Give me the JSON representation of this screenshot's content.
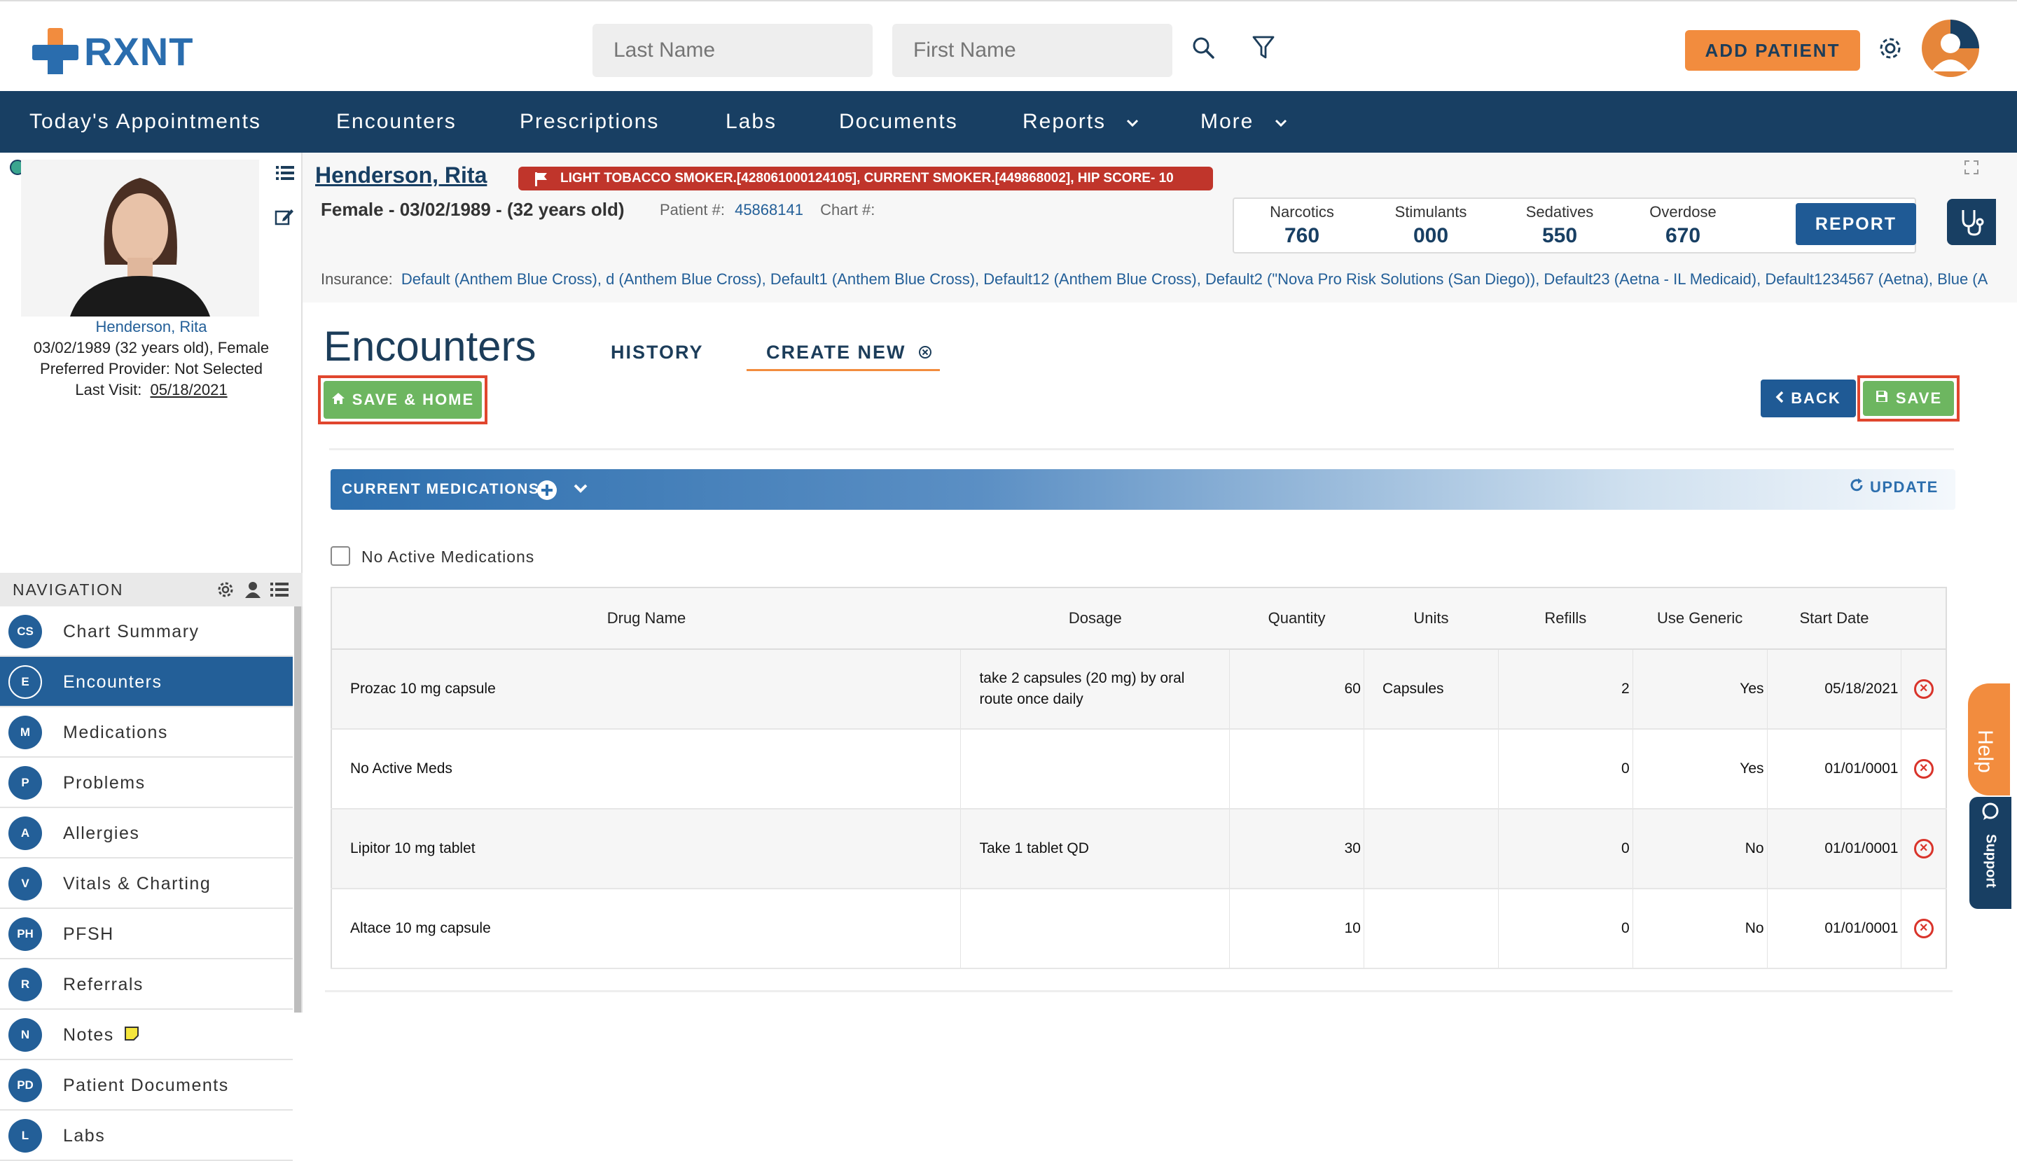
{
  "app": {
    "logo_text": "RXNT"
  },
  "topbar": {
    "last_name_placeholder": "Last Name",
    "first_name_placeholder": "First Name",
    "add_patient_label": "ADD PATIENT"
  },
  "nav": {
    "items": [
      {
        "label": "Today's Appointments"
      },
      {
        "label": "Encounters"
      },
      {
        "label": "Prescriptions"
      },
      {
        "label": "Labs"
      },
      {
        "label": "Documents"
      },
      {
        "label": "Reports"
      },
      {
        "label": "More"
      }
    ]
  },
  "patient_card": {
    "name": "Henderson, Rita",
    "dob_line": "03/02/1989 (32 years old), Female",
    "provider_line": "Preferred Provider: Not Selected",
    "last_visit_label": "Last Visit:",
    "last_visit_date": "05/18/2021"
  },
  "navigation": {
    "title": "NAVIGATION",
    "items": [
      {
        "badge": "CS",
        "label": "Chart Summary"
      },
      {
        "badge": "E",
        "label": "Encounters"
      },
      {
        "badge": "M",
        "label": "Medications"
      },
      {
        "badge": "P",
        "label": "Problems"
      },
      {
        "badge": "A",
        "label": "Allergies"
      },
      {
        "badge": "V",
        "label": "Vitals & Charting"
      },
      {
        "badge": "PH",
        "label": "PFSH"
      },
      {
        "badge": "R",
        "label": "Referrals"
      },
      {
        "badge": "N",
        "label": "Notes"
      },
      {
        "badge": "PD",
        "label": "Patient Documents"
      },
      {
        "badge": "L",
        "label": "Labs"
      }
    ]
  },
  "header": {
    "patient_name": "Henderson, Rita",
    "flags": "LIGHT TOBACCO SMOKER.[428061000124105], CURRENT SMOKER.[449868002], HIP SCORE- 10",
    "demographics": "Female - 03/02/1989 - (32 years old)",
    "patient_no_label": "Patient #:",
    "patient_no": "45868141",
    "chart_no_label": "Chart #:",
    "insurance_label": "Insurance:",
    "insurance": "Default (Anthem Blue Cross), d (Anthem Blue Cross), Default1 (Anthem Blue Cross), Default12 (Anthem Blue Cross), Default2 (\"Nova Pro Risk Solutions (San Diego)), Default23 (Aetna - IL Medicaid), Default1234567 (Aetna), Blue (A"
  },
  "pdmp": {
    "items": [
      {
        "label": "Narcotics",
        "value": "760"
      },
      {
        "label": "Stimulants",
        "value": "000"
      },
      {
        "label": "Sedatives",
        "value": "550"
      },
      {
        "label": "Overdose",
        "value": "670"
      }
    ],
    "report_label": "REPORT"
  },
  "encounters": {
    "title": "Encounters",
    "tab_history": "HISTORY",
    "tab_create_new": "CREATE NEW",
    "save_home_label": "SAVE & HOME",
    "back_label": "BACK",
    "save_label": "SAVE"
  },
  "medications": {
    "section_title": "CURRENT MEDICATIONS",
    "update_label": "UPDATE",
    "no_active_label": "No Active Medications",
    "columns": [
      "Drug Name",
      "Dosage",
      "Quantity",
      "Units",
      "Refills",
      "Use Generic",
      "Start Date"
    ],
    "rows": [
      {
        "drug": "Prozac 10 mg capsule",
        "dosage": "take 2 capsules (20 mg) by oral route once daily",
        "quantity": "60",
        "units": "Capsules",
        "refills": "2",
        "generic": "Yes",
        "start": "05/18/2021"
      },
      {
        "drug": "No Active Meds",
        "dosage": "",
        "quantity": "",
        "units": "",
        "refills": "0",
        "generic": "Yes",
        "start": "01/01/0001"
      },
      {
        "drug": "Lipitor 10 mg tablet",
        "dosage": "Take 1 tablet QD",
        "quantity": "30",
        "units": "",
        "refills": "0",
        "generic": "No",
        "start": "01/01/0001"
      },
      {
        "drug": "Altace 10 mg capsule",
        "dosage": "",
        "quantity": "10",
        "units": "",
        "refills": "0",
        "generic": "No",
        "start": "01/01/0001"
      }
    ]
  },
  "widgets": {
    "help_label": "Help",
    "support_label": "Support"
  },
  "colors": {
    "navy": "#183f63",
    "brand_blue": "#2a6dae",
    "orange": "#f28c3e",
    "green": "#6db660",
    "flag_red": "#c0352b"
  }
}
